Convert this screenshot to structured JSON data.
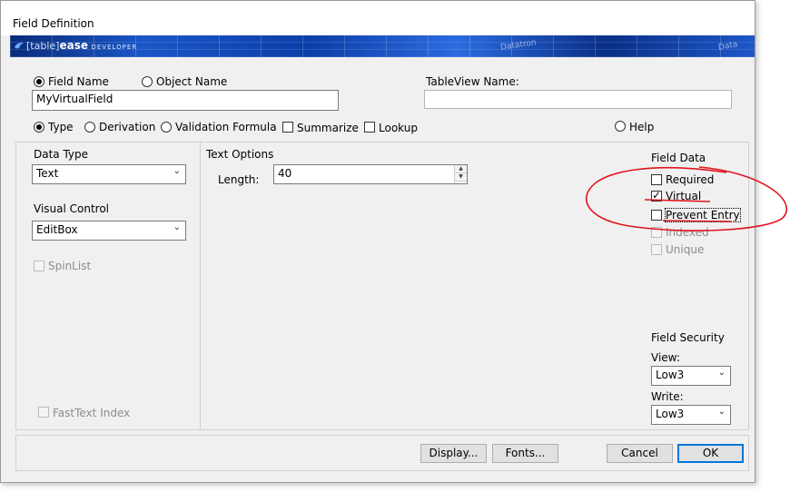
{
  "window": {
    "title": "Field Definition"
  },
  "banner": {
    "logo_bracket": "[table]",
    "logo_name": "ease",
    "logo_suffix": "DEVELOPER",
    "bg_text_1": "Datatron",
    "bg_text_2": "Data"
  },
  "name_mode": {
    "field_name_label": "Field Name",
    "object_name_label": "Object Name",
    "selected": "Field Name",
    "value": "MyVirtualField"
  },
  "tableview": {
    "label": "TableView Name:",
    "value": ""
  },
  "tabs": {
    "type_label": "Type",
    "derivation_label": "Derivation",
    "validation_label": "Validation Formula",
    "summarize_label": "Summarize",
    "lookup_label": "Lookup",
    "help_label": "Help",
    "selected": "Type"
  },
  "left": {
    "data_type_label": "Data Type",
    "data_type_value": "Text",
    "visual_control_label": "Visual Control",
    "visual_control_value": "EditBox",
    "spinlist_label": "SpinList",
    "fasttext_label": "FastText Index"
  },
  "text_options": {
    "group_label": "Text Options",
    "length_label": "Length:",
    "length_value": "40"
  },
  "field_data": {
    "group_label": "Field Data",
    "required_label": "Required",
    "virtual_label": "Virtual",
    "prevent_entry_label": "Prevent Entry",
    "indexed_label": "Indexed",
    "unique_label": "Unique",
    "virtual_checked": true
  },
  "field_security": {
    "group_label": "Field Security",
    "view_label": "View:",
    "view_value": "Low3",
    "write_label": "Write:",
    "write_value": "Low3"
  },
  "buttons": {
    "display_label": "Display...",
    "fonts_label": "Fonts...",
    "cancel_label": "Cancel",
    "ok_label": "OK"
  },
  "colors": {
    "annotation": "#e0141e",
    "accent": "#0078d7",
    "banner": "#1a56c8"
  }
}
